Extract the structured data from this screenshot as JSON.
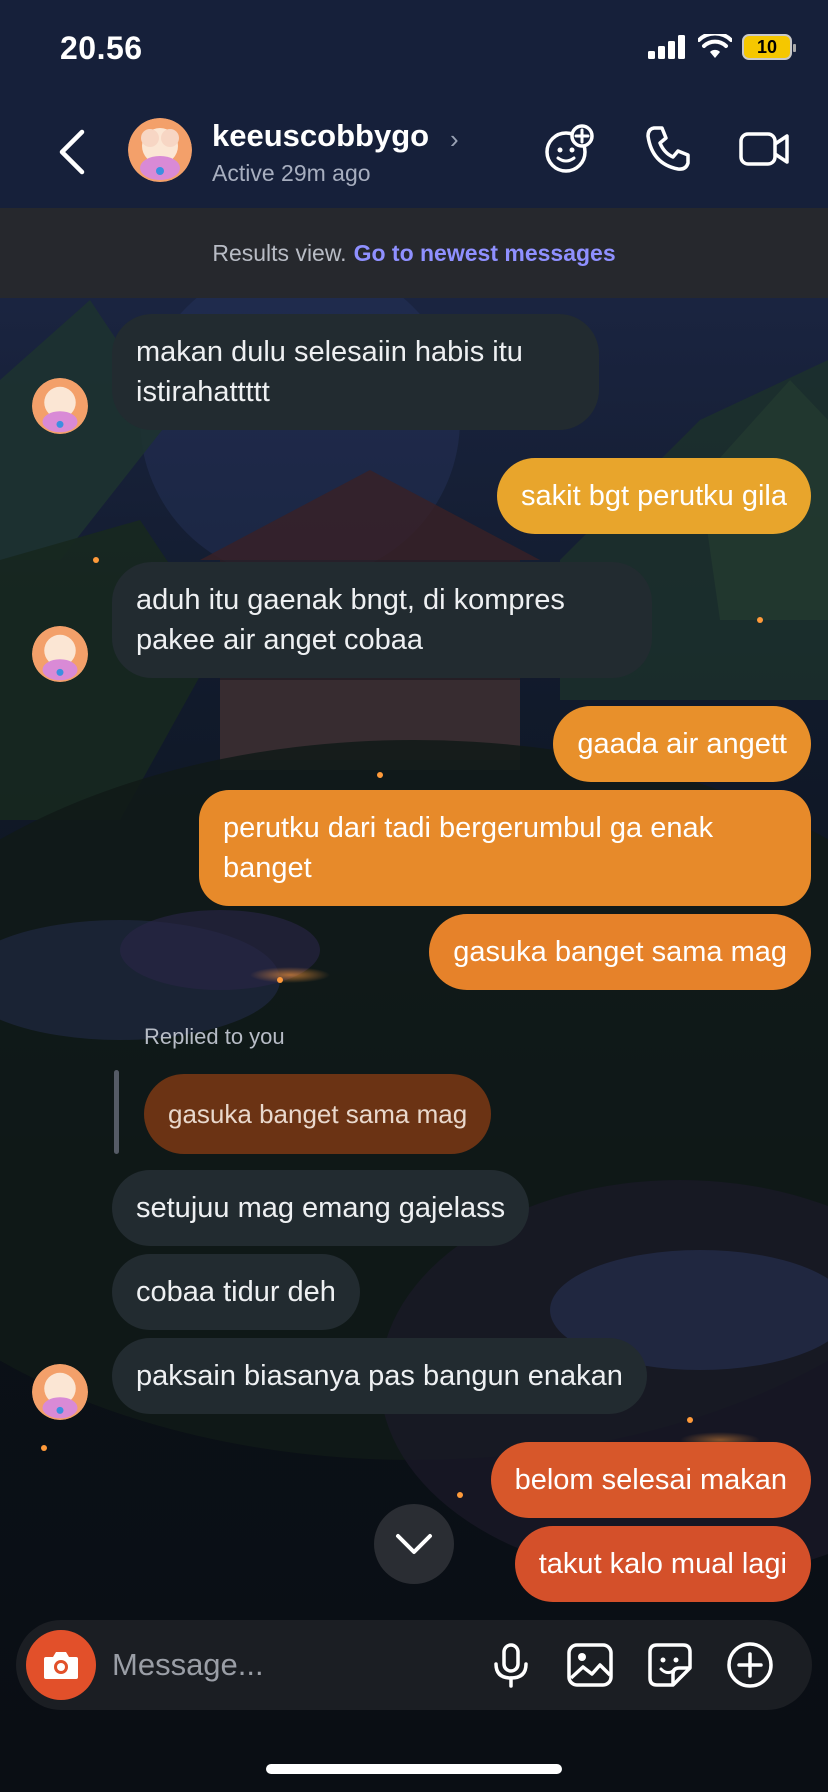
{
  "status_bar": {
    "time": "20.56",
    "battery": "10"
  },
  "header": {
    "username": "keeuscobbygo",
    "active": "Active 29m ago"
  },
  "results": {
    "text": "Results view.",
    "link": "Go to newest messages"
  },
  "messages": [
    {
      "dir": "in",
      "text_lines": [
        "makan dulu selesaiin habis itu",
        "istirahattttt"
      ]
    },
    {
      "dir": "out",
      "text": "sakit bgt perutku gila",
      "color": "#e8a52c"
    },
    {
      "dir": "in",
      "text_lines": [
        "aduh itu gaenak bngt, di kompres",
        "pakee air anget cobaa"
      ]
    },
    {
      "dir": "out",
      "text": "gaada air angett",
      "color": "#e8902b"
    },
    {
      "dir": "out",
      "text_lines": [
        "perutku dari tadi bergerumbul ga enak",
        "banget"
      ],
      "color": "#e78a2a"
    },
    {
      "dir": "out",
      "text": "gasuka banget sama mag",
      "color": "#e6822a"
    },
    {
      "dir": "in",
      "text": "setujuu mag emang gajelass"
    },
    {
      "dir": "in",
      "text": "cobaa tidur deh"
    },
    {
      "dir": "in",
      "text": "paksain biasanya pas bangun enakan"
    },
    {
      "dir": "out",
      "text": "belom selesai makan",
      "color": "#d7572a"
    },
    {
      "dir": "out",
      "text": "takut kalo mual lagi",
      "color": "#d4502a"
    }
  ],
  "reply": {
    "label": "Replied to you",
    "quote": "gasuka banget sama mag"
  },
  "composer": {
    "placeholder": "Message..."
  },
  "colors": {
    "accent_link": "#8f90ff",
    "incoming_bubble": "#222b30",
    "camera": "#e2502a"
  },
  "icons": [
    "back-icon",
    "chevron-right-icon",
    "add-effects-icon",
    "phone-icon",
    "video-icon",
    "chevron-down-icon",
    "camera-icon",
    "microphone-icon",
    "gallery-icon",
    "sticker-icon",
    "plus-icon"
  ]
}
